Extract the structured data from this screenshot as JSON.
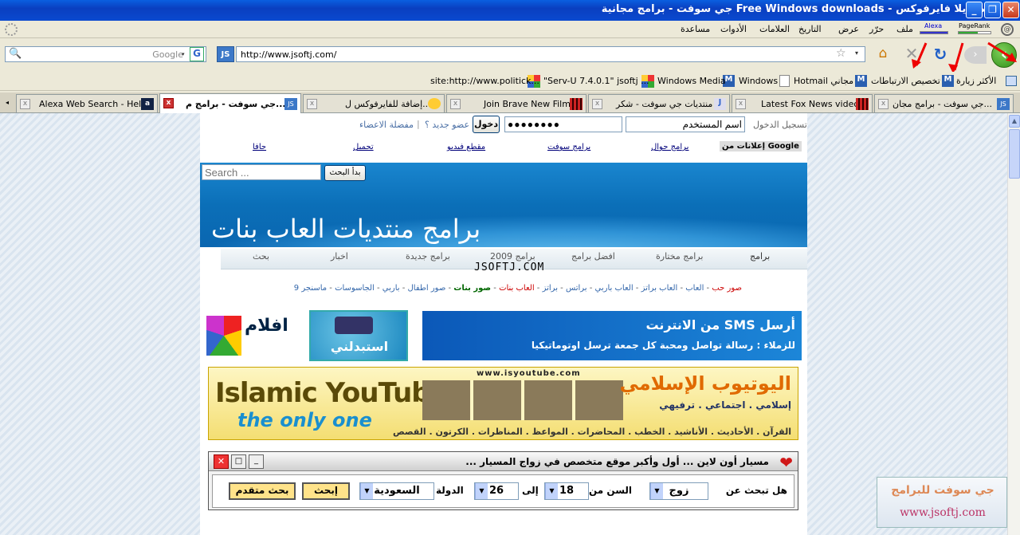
{
  "window": {
    "title": "موزيلا فايرفوكس - Free Windows downloads جي سوفت - برامج مجانية"
  },
  "menubar": {
    "items": [
      "ملف",
      "حرّر",
      "عرض",
      "التاريخ",
      "العلامات",
      "الأدوات",
      "مساعدة"
    ],
    "pagerank_label": "PageRank",
    "alexa_label": "Alexa"
  },
  "navbar": {
    "url": "http://www.jsoftj.com/",
    "search_placeholder": "Google"
  },
  "bookmarks": {
    "items": [
      "الأكثر زيارة",
      "تخصيص الارتباطات",
      "Hotmail مجاني",
      "Windows",
      "Windows Media",
      "\"Serv-U 7.4.0.1\" jsoftj ...",
      "site:http://www.politick..."
    ]
  },
  "tabs": {
    "items": [
      {
        "label": "جي سوفت - برامج مجان...",
        "active": false
      },
      {
        "label": "Latest Fox News videos",
        "active": false
      },
      {
        "label": "منتديات جي سوفت - شكر",
        "active": false
      },
      {
        "label": "Join Brave New Films",
        "active": false
      },
      {
        "label": "إضافة للفايرفوكس ل...",
        "active": false
      },
      {
        "label": "جي سوفت - برامج م...",
        "active": true
      },
      {
        "label": "Alexa Web Search - Help",
        "active": false
      }
    ]
  },
  "page": {
    "login": {
      "label": "تسجيل الدخول",
      "username_value": "اسم المستخدم",
      "password_value": "●●●●●●●●",
      "login_button": "دخول",
      "new_member": "عضو جديد ؟",
      "favorites": "مفضلة الاعضاء"
    },
    "toplinks": [
      "إعلانات من Google",
      "برامج جوال",
      "برامج سوفت",
      "مقطع فيديو",
      "تحميل",
      "جافا"
    ],
    "search": {
      "placeholder": "Search ...",
      "button": "بدأ البحث"
    },
    "banner_title": "برامج  منتديات  العاب بنات",
    "nav2": [
      "برامج",
      "برامج مختارة",
      "افضل برامج",
      "برامج 2009",
      "برامج جديدة",
      "اخبار",
      "بحث"
    ],
    "site_name": "JSOFTJ.COM",
    "category_links": [
      "صور حب",
      "العاب",
      "العاب براتز",
      "العاب باربي",
      "براتس",
      "براتز",
      "العاب بنات",
      "صور بنات",
      "صور اطفال",
      "باربي",
      "الجاسوسات",
      "ماسنجر 9"
    ],
    "ads": {
      "sms_title": "أرسل SMS من الانترنت",
      "sms_sub": "للزملاء : رسالة تواصل ومحبة كل جمعة ترسل اوتوماتيكيا",
      "films": "افلام",
      "istabdilni": "استبدلني",
      "iy_title_en": "Islamic YouTube",
      "iy_sub_en": "the only one",
      "iy_url": "www.isyoutube.com",
      "iy_title_ar": "اليوتيوب الإسلامي",
      "iy_tags": "إسلامي . اجتماعي . ترفيهي",
      "iy_cats": "القرآن . الأحاديث . الأناشيد . الخطب . المحاضرات . المواعظ . المناظرات . الكرتون . القصص"
    },
    "marriage": {
      "title": "مسيار أون لاين ... أول وأكبر موقع متخصص في زواج المسيار ...",
      "search_for_label": "هل تبحث عن",
      "search_for_value": "زوج",
      "age_from_label": "السن من",
      "age_from": "18",
      "to_label": "إلى",
      "age_to": "26",
      "country_label": "الدولة",
      "country_value": "السعودية",
      "search_button": "إبحث",
      "advanced_button": "بحث متقدم"
    },
    "watermark": {
      "line1": "جي سوفت للبرامج",
      "url": "www.jsoftj.com"
    }
  }
}
